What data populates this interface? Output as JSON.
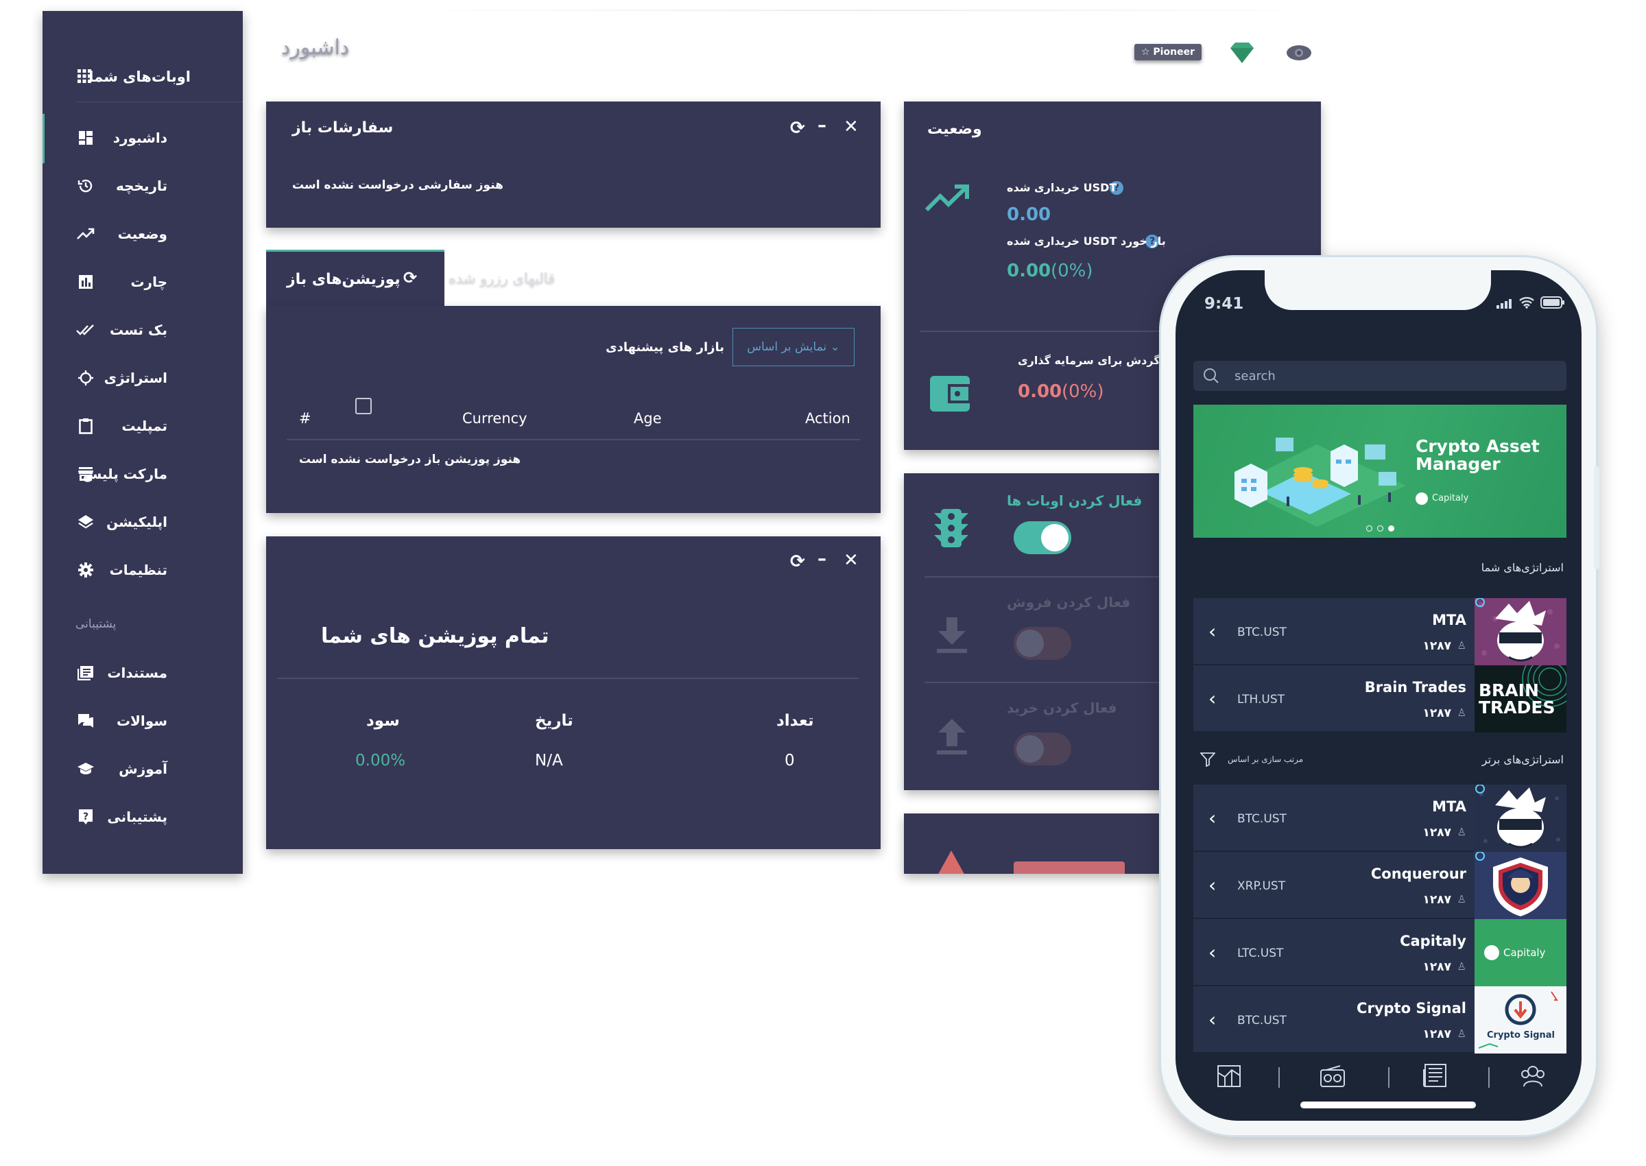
{
  "colors": {
    "panel": "#363755",
    "accent": "#4fb59e",
    "coral": "#d96b6b",
    "phone_bg": "#1b2536"
  },
  "sidebar": {
    "app_title": "اوبات‌های شما",
    "items": [
      {
        "label": "داشبورد",
        "icon": "dashboard-icon"
      },
      {
        "label": "تاریخچه",
        "icon": "history-icon"
      },
      {
        "label": "وضعیت",
        "icon": "trending-up-icon"
      },
      {
        "label": "چارت",
        "icon": "bar-chart-icon"
      },
      {
        "label": "بک تست",
        "icon": "double-check-icon"
      },
      {
        "label": "استراتژی",
        "icon": "target-icon"
      },
      {
        "label": "تمپلیت",
        "icon": "clipboard-icon"
      },
      {
        "label": "مارکت پلیس",
        "icon": "store-icon"
      },
      {
        "label": "اپلیکیشن",
        "icon": "layers-icon"
      },
      {
        "label": "تنظیمات",
        "icon": "gear-icon"
      }
    ],
    "support_heading": "پشتیبانی",
    "support_items": [
      {
        "label": "مستندات",
        "icon": "docs-icon"
      },
      {
        "label": "سوالات",
        "icon": "chat-icon"
      },
      {
        "label": "آموزش",
        "icon": "graduation-icon"
      },
      {
        "label": "پشتیبانی",
        "icon": "help-icon"
      }
    ]
  },
  "header": {
    "title": "داشبورد",
    "badge": "☆ Pioneer"
  },
  "open_orders": {
    "title": "سفارشات باز",
    "empty": "هنوز سفارشی درخواست نشده است"
  },
  "positions": {
    "tab_active": "پوزیشن‌های باز",
    "tab_inactive": "قالبهای رزرو شده",
    "filter_label": "بازار های پیشنهادی",
    "filter_button": "⌄ نمایش بر اساس",
    "columns": [
      "#",
      "Currency",
      "Age",
      "Action"
    ],
    "empty": "هنوز پوزیشن باز درخواست نشده است"
  },
  "all_positions": {
    "title": "تمام پوزیشن های شما",
    "headers": [
      "سود",
      "تاریخ",
      "تعداد"
    ],
    "values": [
      "0.00%",
      "N/A",
      "0"
    ]
  },
  "status": {
    "title": "وضعیت",
    "usdt_bought_label": "USDT خریداری شده",
    "usdt_bought_value": "0.00",
    "usdt_load_label": "بار خورد USDT خریداری شده",
    "usdt_load_value": "0.00",
    "usdt_load_pct": "(0%)",
    "invest_label": "US در گردش برای سرمایه گذاری",
    "invest_value": "0.00",
    "invest_pct": "(0%)"
  },
  "toggles": {
    "activate_bots": "فعال کردن اوبات ها",
    "activate_sell": "فعال کردن فروش",
    "activate_buy": "فعال کردن خرید"
  },
  "phone": {
    "time": "9:41",
    "search_placeholder": "search",
    "banner_title_1": "Crypto Asset",
    "banner_title_2": "Manager",
    "banner_brand": "Capitaly",
    "section_my": "استراتژی‌های شما",
    "section_top": "استراتژی‌های برتر",
    "sort_label": "مرتب سازی بر اساس",
    "my_strategies": [
      {
        "name": "MTA",
        "pair": "BTC.UST",
        "count": "۱۲۸۷"
      },
      {
        "name": "Brain Trades",
        "pair": "LTH.UST",
        "count": "۱۲۸۷",
        "thumb_text": "BRAIN TRADES"
      }
    ],
    "top_strategies": [
      {
        "name": "MTA",
        "pair": "BTC.UST",
        "count": "۱۲۸۷"
      },
      {
        "name": "Conquerour",
        "pair": "XRP.UST",
        "count": "۱۲۸۷"
      },
      {
        "name": "Capitaly",
        "pair": "LTC.UST",
        "count": "۱۲۸۷",
        "thumb_text": "Capitaly"
      },
      {
        "name": "Crypto Signal",
        "pair": "BTC.UST",
        "count": "۱۲۸۷",
        "thumb_text": "Crypto Signal"
      }
    ]
  }
}
